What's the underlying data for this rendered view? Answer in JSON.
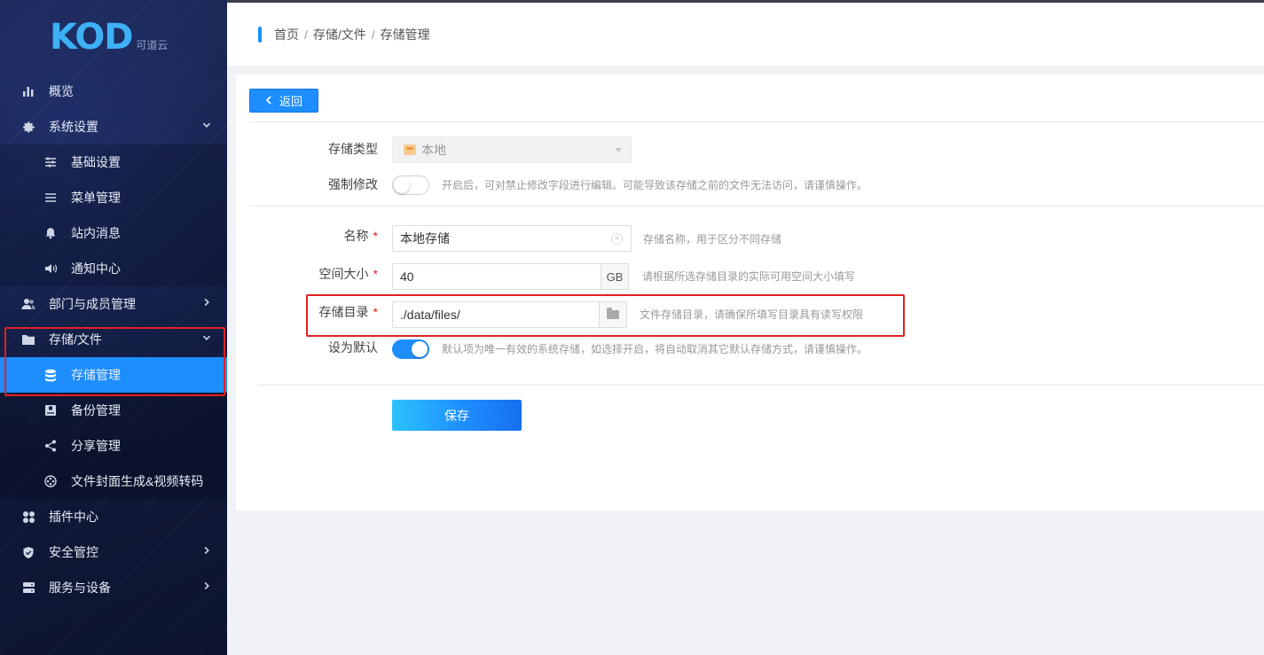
{
  "logo": {
    "main": "KOD",
    "sub": "可道云"
  },
  "sidebar": {
    "items": [
      {
        "label": "概览",
        "icon": "chart-bar-icon"
      },
      {
        "label": "系统设置",
        "icon": "gear-icon"
      },
      {
        "label": "基础设置",
        "icon": "sliders-icon"
      },
      {
        "label": "菜单管理",
        "icon": "menu-lines-icon"
      },
      {
        "label": "站内消息",
        "icon": "bell-icon"
      },
      {
        "label": "通知中心",
        "icon": "speaker-icon"
      },
      {
        "label": "部门与成员管理",
        "icon": "users-icon"
      },
      {
        "label": "存储/文件",
        "icon": "folder-icon"
      },
      {
        "label": "存储管理",
        "icon": "database-icon"
      },
      {
        "label": "备份管理",
        "icon": "backup-icon"
      },
      {
        "label": "分享管理",
        "icon": "share-icon"
      },
      {
        "label": "文件封面生成&视频转码",
        "icon": "film-reel-icon"
      },
      {
        "label": "插件中心",
        "icon": "plugin-grid-icon"
      },
      {
        "label": "安全管控",
        "icon": "shield-icon"
      },
      {
        "label": "服务与设备",
        "icon": "server-icon"
      }
    ]
  },
  "breadcrumb": {
    "home": "首页",
    "sep": "/",
    "section": "存储/文件",
    "current": "存储管理"
  },
  "actions": {
    "back_label": "返回",
    "save_label": "保存"
  },
  "form": {
    "storage_type": {
      "label": "存储类型",
      "value": "本地"
    },
    "force_modify": {
      "label": "强制修改",
      "hint": "开启后，可对禁止修改字段进行编辑。可能导致该存储之前的文件无法访问，请谨慎操作。",
      "enabled": false
    },
    "name": {
      "label": "名称",
      "value": "本地存储",
      "hint": "存储名称，用于区分不同存储"
    },
    "space_size": {
      "label": "空间大小",
      "value": "40",
      "unit": "GB",
      "hint": "请根据所选存储目录的实际可用空间大小填写"
    },
    "storage_dir": {
      "label": "存储目录",
      "value": "./data/files/",
      "hint": "文件存储目录，请确保所填写目录具有读写权限"
    },
    "set_default": {
      "label": "设为默认",
      "hint": "默认项为唯一有效的系统存储，如选择开启，将自动取消其它默认存储方式，请谨慎操作。",
      "enabled": true
    },
    "required_mark": "*"
  },
  "colors": {
    "accent": "#1e8eff",
    "highlight": "#e02020",
    "sidebar_bg": "#101a3c"
  }
}
